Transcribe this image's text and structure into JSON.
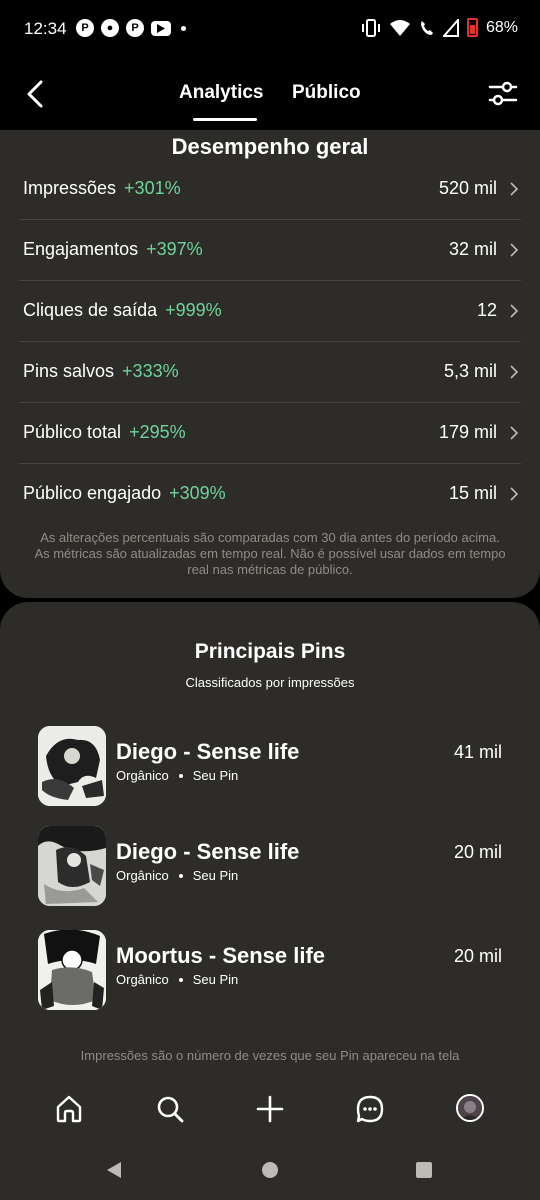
{
  "status_bar": {
    "time": "12:34",
    "battery": "68%",
    "notification_icons": [
      "pinterest-icon",
      "reddit-icon",
      "pinterest-icon",
      "youtube-icon"
    ]
  },
  "header": {
    "tabs": [
      {
        "label": "Analytics",
        "active": true
      },
      {
        "label": "Público",
        "active": false
      }
    ]
  },
  "performance": {
    "title": "Desempenho geral",
    "metrics": [
      {
        "label": "Impressões",
        "delta": "+301%",
        "value": "520 mil"
      },
      {
        "label": "Engajamentos",
        "delta": "+397%",
        "value": "32 mil"
      },
      {
        "label": "Cliques de saída",
        "delta": "+999%",
        "value": "12"
      },
      {
        "label": "Pins salvos",
        "delta": "+333%",
        "value": "5,3 mil"
      },
      {
        "label": "Público total",
        "delta": "+295%",
        "value": "179 mil"
      },
      {
        "label": "Público engajado",
        "delta": "+309%",
        "value": "15 mil"
      }
    ],
    "note_line1": "As alterações percentuais são comparadas com 30 dia antes do período acima.",
    "note_line2": "As métricas são atualizadas em tempo real. Não é possível usar dados em tempo",
    "note_line3": "real nas métricas de público."
  },
  "top_pins": {
    "title": "Principais Pins",
    "subtitle": "Classificados por impressões",
    "pins": [
      {
        "title": "Diego - Sense life",
        "type": "Orgânico",
        "owner": "Seu Pin",
        "count": "41 mil"
      },
      {
        "title": "Diego - Sense life",
        "type": "Orgânico",
        "owner": "Seu Pin",
        "count": "20 mil"
      },
      {
        "title": "Moortus - Sense life",
        "type": "Orgânico",
        "owner": "Seu Pin",
        "count": "20 mil"
      }
    ],
    "footnote": "Impressões são o número de vezes que seu Pin apareceu na tela"
  },
  "colors": {
    "background": "#000000",
    "card": "#2d2c28",
    "positive_delta": "#6fd39c",
    "muted_text": "#8e8c85",
    "battery": "#e0352b"
  }
}
